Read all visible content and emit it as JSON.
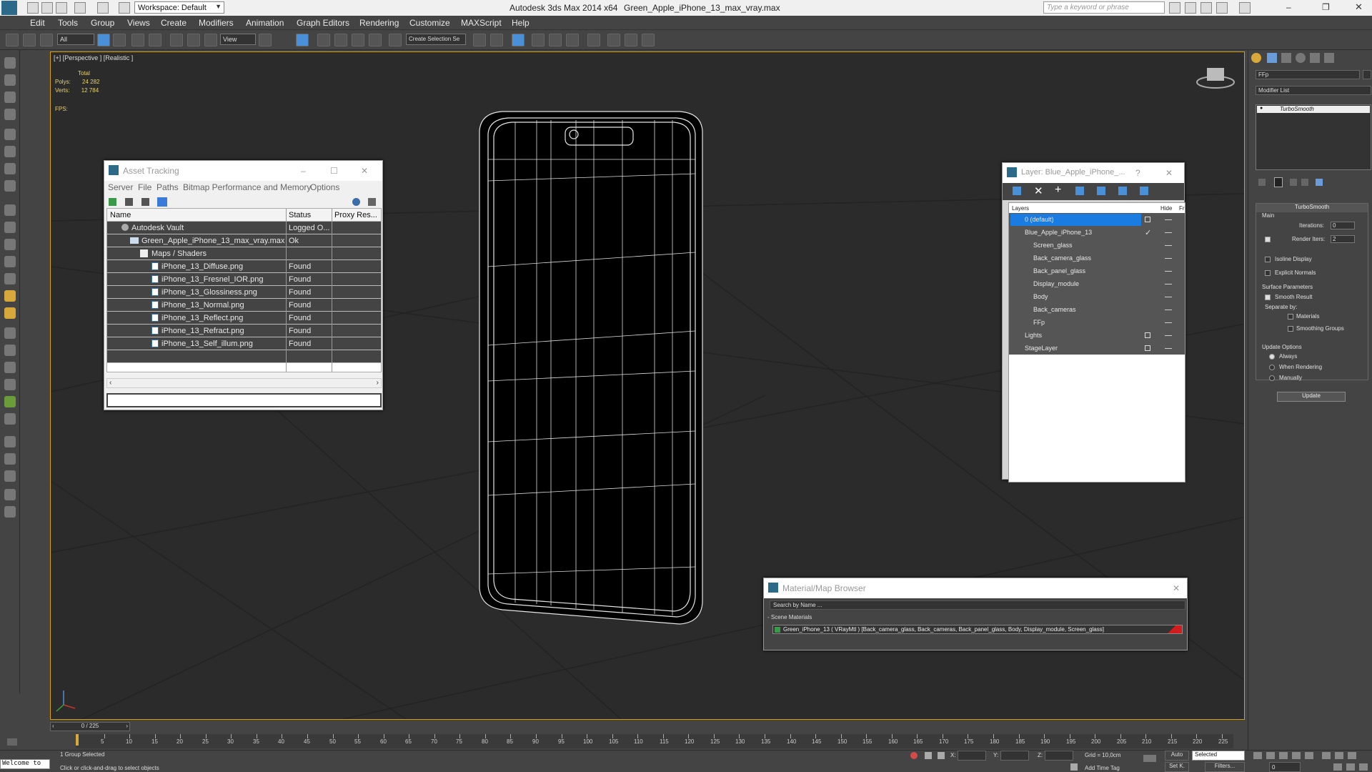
{
  "titlebar": {
    "workspace_label": "Workspace: Default",
    "app_title": "Autodesk 3ds Max  2014 x64",
    "file_title": "Green_Apple_iPhone_13_max_vray.max",
    "search_placeholder": "Type a keyword or phrase"
  },
  "menu": [
    "Edit",
    "Tools",
    "Group",
    "Views",
    "Create",
    "Modifiers",
    "Animation",
    "Graph Editors",
    "Rendering",
    "Customize",
    "MAXScript",
    "Help"
  ],
  "toolbar": {
    "selection_filter": "All",
    "ref_coord": "View",
    "named_selection": "Create Selection Se"
  },
  "viewport": {
    "label": "[+] [Perspective ] [Realistic ]",
    "stats_total": "Total",
    "polys_label": "Polys:",
    "polys_value": "24 282",
    "verts_label": "Verts:",
    "verts_value": "12 784",
    "fps_label": "FPS:"
  },
  "asset_tracking": {
    "title": "Asset Tracking",
    "menu": [
      "Server",
      "File",
      "Paths",
      "Bitmap Performance and Memory",
      "Options"
    ],
    "columns": [
      "Name",
      "Status",
      "Proxy Res..."
    ],
    "rows": [
      {
        "name": "Autodesk Vault",
        "status": "Logged O...",
        "indent": 0
      },
      {
        "name": "Green_Apple_iPhone_13_max_vray.max",
        "status": "Ok",
        "indent": 1
      },
      {
        "name": "Maps / Shaders",
        "status": "",
        "indent": 2
      },
      {
        "name": "iPhone_13_Diffuse.png",
        "status": "Found",
        "indent": 3
      },
      {
        "name": "iPhone_13_Fresnel_IOR.png",
        "status": "Found",
        "indent": 3
      },
      {
        "name": "iPhone_13_Glossiness.png",
        "status": "Found",
        "indent": 3
      },
      {
        "name": "iPhone_13_Normal.png",
        "status": "Found",
        "indent": 3
      },
      {
        "name": "iPhone_13_Reflect.png",
        "status": "Found",
        "indent": 3
      },
      {
        "name": "iPhone_13_Refract.png",
        "status": "Found",
        "indent": 3
      },
      {
        "name": "iPhone_13_Self_illum.png",
        "status": "Found",
        "indent": 3
      }
    ]
  },
  "layers": {
    "title": "Layer: Blue_Apple_iPhone_...",
    "help": "?",
    "col_layers": "Layers",
    "col_hide": "Hide",
    "col_fr": "Fr",
    "rows": [
      {
        "name": "0 (default)",
        "level": 0,
        "selected": true
      },
      {
        "name": "Blue_Apple_iPhone_13",
        "level": 0,
        "selected": false
      },
      {
        "name": "Screen_glass",
        "level": 1,
        "selected": false
      },
      {
        "name": "Back_camera_glass",
        "level": 1,
        "selected": false
      },
      {
        "name": "Back_panel_glass",
        "level": 1,
        "selected": false
      },
      {
        "name": "Display_module",
        "level": 1,
        "selected": false
      },
      {
        "name": "Body",
        "level": 1,
        "selected": false
      },
      {
        "name": "Back_cameras",
        "level": 1,
        "selected": false
      },
      {
        "name": "FFp",
        "level": 1,
        "selected": false
      },
      {
        "name": "Lights",
        "level": 0,
        "selected": false
      },
      {
        "name": "StageLayer",
        "level": 0,
        "selected": false
      }
    ]
  },
  "material_browser": {
    "title": "Material/Map Browser",
    "search_placeholder": "Search by Name ...",
    "section": "- Scene Materials",
    "item": "Green_iPhone_13  ( VRayMtl )  [Back_camera_glass, Back_cameras, Back_panel_glass, Body, Display_module, Screen_glass]"
  },
  "command_panel": {
    "object_name": "FFp",
    "modifier_list": "Modifier List",
    "stack_item": "TurboSmooth",
    "rollout_title": "TurboSmooth",
    "main_label": "Main",
    "iterations_label": "Iterations:",
    "iterations_value": "0",
    "render_iters_label": "Render Iters:",
    "render_iters_value": "2",
    "isoline_label": "Isoline Display",
    "explicit_normals_label": "Explicit Normals",
    "surface_params_label": "Surface Parameters",
    "smooth_result_label": "Smooth Result",
    "separate_by_label": "Separate by:",
    "materials_label": "Materials",
    "smoothing_groups_label": "Smoothing Groups",
    "update_options_label": "Update Options",
    "always_label": "Always",
    "when_rendering_label": "When Rendering",
    "manually_label": "Manually",
    "update_button": "Update"
  },
  "timeline": {
    "frame_counter": "0 / 225",
    "ticks": [
      5,
      10,
      15,
      20,
      25,
      30,
      35,
      40,
      45,
      50,
      55,
      60,
      65,
      70,
      75,
      80,
      85,
      90,
      95,
      100,
      105,
      110,
      115,
      120,
      125,
      130,
      135,
      140,
      145,
      150,
      155,
      160,
      165,
      170,
      175,
      180,
      185,
      190,
      195,
      200,
      205,
      210,
      215,
      220,
      225
    ]
  },
  "status": {
    "welcome": "Welcome to",
    "selection": "1 Group Selected",
    "prompt": "Click or click-and-drag to select objects",
    "x_label": "X:",
    "y_label": "Y:",
    "z_label": "Z:",
    "grid": "Grid = 10,0cm",
    "add_time_tag": "Add Time Tag",
    "auto": "Auto",
    "selected": "Selected",
    "set_k": "Set K.",
    "filters": "Filters...",
    "frame_value": "0"
  }
}
